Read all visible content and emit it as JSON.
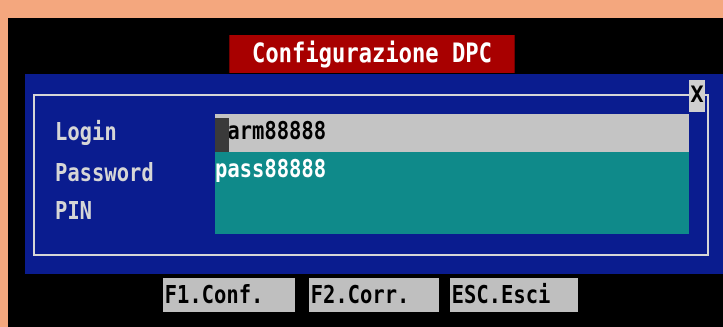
{
  "dialog": {
    "title": "Configurazione DPC",
    "close_label": "X"
  },
  "form": {
    "fields": [
      {
        "label": "Login",
        "value": "Farm88888"
      },
      {
        "label": "Password",
        "value": "pass88888"
      },
      {
        "label": "PIN",
        "value": ""
      }
    ]
  },
  "function_keys": [
    {
      "label": "F1.Conf."
    },
    {
      "label": "F2.Corr."
    },
    {
      "label": "ESC.Esci"
    }
  ],
  "colors": {
    "screen_background": "#000000",
    "dialog_background": "#0a1c8f",
    "title_background": "#a80000",
    "active_field": "#c4c4c4",
    "inactive_field": "#0f8a8a"
  }
}
